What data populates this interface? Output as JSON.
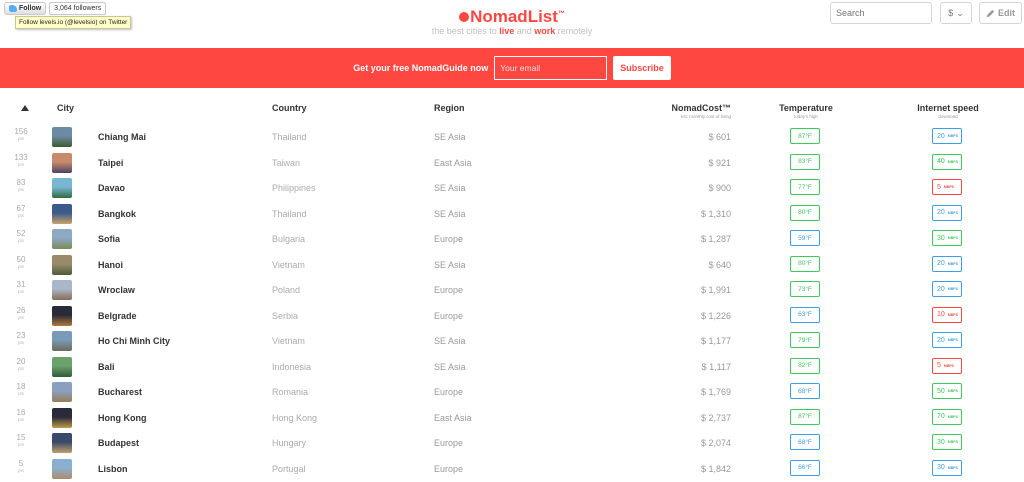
{
  "twitter": {
    "follow": "Follow",
    "followers": "3,064 followers",
    "tooltip": "Follow levels.io (@levelsio) on Twitter"
  },
  "logo": {
    "name": "NomadList",
    "tm": "™"
  },
  "tagline": {
    "a": "the best cities to ",
    "b": "live",
    "c": " and ",
    "d": "work",
    "e": " remotely"
  },
  "search": {
    "placeholder": "Search"
  },
  "currency": {
    "value": "$",
    "arrow": "⌄"
  },
  "edit": {
    "label": "Edit"
  },
  "banner": {
    "text": "Get your free NomadGuide now",
    "email_placeholder": "Your email",
    "subscribe": "Subscribe"
  },
  "columns": {
    "city": "City",
    "country": "Country",
    "region": "Region",
    "cost": "NomadCost™",
    "cost_sub": "est. monthly cost of living",
    "temp": "Temperature",
    "temp_sub": "today's high",
    "net": "Internet speed",
    "net_sub": "download"
  },
  "rank_unit": "pts",
  "speed_unit": "MBPS",
  "colors": {
    "brand": "#ff4742",
    "good": "#3dc95b",
    "mid": "#3da0e6",
    "bad": "#ff4742"
  },
  "rows": [
    {
      "rank": "156",
      "city": "Chiang Mai",
      "country": "Thailand",
      "region": "SE Asia",
      "cost": "$ 601",
      "temp": "87°F",
      "temp_c": "green",
      "speed": "20",
      "speed_c": "blue",
      "thumb": [
        "#6b8aa3",
        "#3f5a2e"
      ]
    },
    {
      "rank": "133",
      "city": "Taipei",
      "country": "Taiwan",
      "region": "East Asia",
      "cost": "$ 921",
      "temp": "83°F",
      "temp_c": "green",
      "speed": "40",
      "speed_c": "green",
      "thumb": [
        "#c98a6b",
        "#4a4266"
      ]
    },
    {
      "rank": "83",
      "city": "Davao",
      "country": "Philippines",
      "region": "SE Asia",
      "cost": "$ 900",
      "temp": "77°F",
      "temp_c": "green",
      "speed": "5",
      "speed_c": "red",
      "thumb": [
        "#79b6d4",
        "#2d6b3f"
      ]
    },
    {
      "rank": "67",
      "city": "Bangkok",
      "country": "Thailand",
      "region": "SE Asia",
      "cost": "$ 1,310",
      "temp": "80°F",
      "temp_c": "green",
      "speed": "20",
      "speed_c": "blue",
      "thumb": [
        "#3a5a8a",
        "#c9a46b"
      ]
    },
    {
      "rank": "52",
      "city": "Sofia",
      "country": "Bulgaria",
      "region": "Europe",
      "cost": "$ 1,287",
      "temp": "59°F",
      "temp_c": "blue",
      "speed": "30",
      "speed_c": "green",
      "thumb": [
        "#8da9c4",
        "#7a8a55"
      ]
    },
    {
      "rank": "50",
      "city": "Hanoi",
      "country": "Vietnam",
      "region": "SE Asia",
      "cost": "$ 640",
      "temp": "80°F",
      "temp_c": "green",
      "speed": "20",
      "speed_c": "blue",
      "thumb": [
        "#9a8a6a",
        "#4c5a3a"
      ]
    },
    {
      "rank": "31",
      "city": "Wroclaw",
      "country": "Poland",
      "region": "Europe",
      "cost": "$ 1,991",
      "temp": "73°F",
      "temp_c": "green",
      "speed": "20",
      "speed_c": "blue",
      "thumb": [
        "#a8b8c8",
        "#8a6a55"
      ]
    },
    {
      "rank": "26",
      "city": "Belgrade",
      "country": "Serbia",
      "region": "Europe",
      "cost": "$ 1,226",
      "temp": "63°F",
      "temp_c": "blue",
      "speed": "10",
      "speed_c": "red",
      "thumb": [
        "#2a2a3a",
        "#b07a3a"
      ]
    },
    {
      "rank": "23",
      "city": "Ho Chi Minh City",
      "country": "Vietnam",
      "region": "SE Asia",
      "cost": "$ 1,177",
      "temp": "79°F",
      "temp_c": "green",
      "speed": "20",
      "speed_c": "blue",
      "thumb": [
        "#7a9ab8",
        "#6a6a5a"
      ]
    },
    {
      "rank": "20",
      "city": "Bali",
      "country": "Indonesia",
      "region": "SE Asia",
      "cost": "$ 1,117",
      "temp": "82°F",
      "temp_c": "green",
      "speed": "5",
      "speed_c": "red",
      "thumb": [
        "#6aa26a",
        "#2f5a3a"
      ]
    },
    {
      "rank": "18",
      "city": "Bucharest",
      "country": "Romania",
      "region": "Europe",
      "cost": "$ 1,769",
      "temp": "68°F",
      "temp_c": "blue",
      "speed": "50",
      "speed_c": "green",
      "thumb": [
        "#8aa0c0",
        "#9a7a5a"
      ]
    },
    {
      "rank": "16",
      "city": "Hong Kong",
      "country": "Hong Kong",
      "region": "East Asia",
      "cost": "$ 2,737",
      "temp": "87°F",
      "temp_c": "green",
      "speed": "70",
      "speed_c": "green",
      "thumb": [
        "#2a2a3a",
        "#c09a4a"
      ]
    },
    {
      "rank": "15",
      "city": "Budapest",
      "country": "Hungary",
      "region": "Europe",
      "cost": "$ 2,074",
      "temp": "68°F",
      "temp_c": "blue",
      "speed": "30",
      "speed_c": "green",
      "thumb": [
        "#3a4a6a",
        "#c0a06a"
      ]
    },
    {
      "rank": "5",
      "city": "Lisbon",
      "country": "Portugal",
      "region": "Europe",
      "cost": "$ 1,842",
      "temp": "66°F",
      "temp_c": "blue",
      "speed": "30",
      "speed_c": "blue",
      "thumb": [
        "#8ab0d0",
        "#b08a6a"
      ]
    }
  ]
}
